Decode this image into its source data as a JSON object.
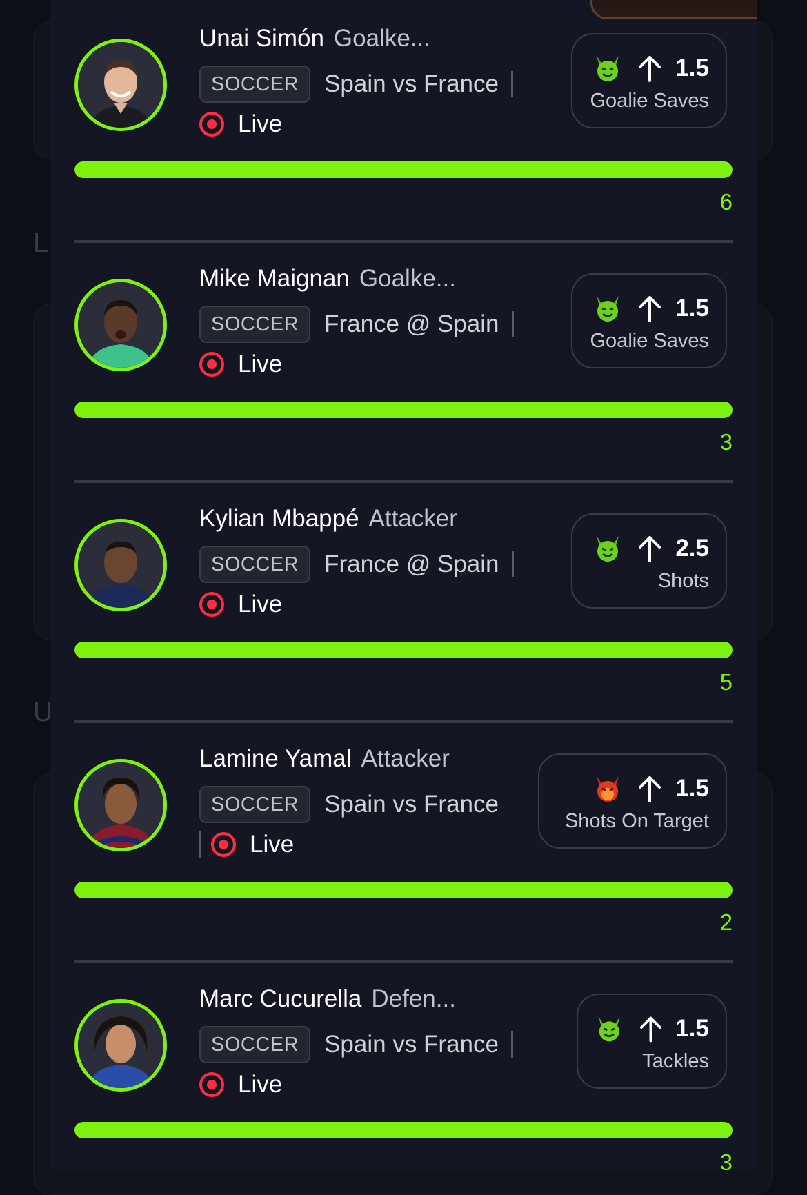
{
  "colors": {
    "accent": "#7ef20f",
    "live": "#ff2d3f",
    "panel": "#141624",
    "background": "#0d0f17"
  },
  "players": [
    {
      "name": "Unai Simón",
      "position": "Goalke...",
      "sport": "SOCCER",
      "matchup": "Spain vs France",
      "status": "Live",
      "pick_icon": "green-devil-icon",
      "direction_icon": "arrow-up-icon",
      "line": "1.5",
      "stat": "Goalie Saves",
      "progress_percent": 100,
      "current_value": "6"
    },
    {
      "name": "Mike Maignan",
      "position": "Goalke...",
      "sport": "SOCCER",
      "matchup": "France @ Spain",
      "status": "Live",
      "pick_icon": "green-devil-icon",
      "direction_icon": "arrow-up-icon",
      "line": "1.5",
      "stat": "Goalie Saves",
      "progress_percent": 100,
      "current_value": "3"
    },
    {
      "name": "Kylian Mbappé",
      "position": "Attacker",
      "sport": "SOCCER",
      "matchup": "France @ Spain",
      "status": "Live",
      "pick_icon": "green-devil-icon",
      "direction_icon": "arrow-up-icon",
      "line": "2.5",
      "stat": "Shots",
      "progress_percent": 100,
      "current_value": "5"
    },
    {
      "name": "Lamine Yamal",
      "position": "Attacker",
      "sport": "SOCCER",
      "matchup": "Spain vs France",
      "status": "Live",
      "pick_icon": "red-devil-icon",
      "direction_icon": "arrow-up-icon",
      "line": "1.5",
      "stat": "Shots On Target",
      "progress_percent": 100,
      "current_value": "2"
    },
    {
      "name": "Marc Cucurella",
      "position": "Defen...",
      "sport": "SOCCER",
      "matchup": "Spain vs France",
      "status": "Live",
      "pick_icon": "green-devil-icon",
      "direction_icon": "arrow-up-icon",
      "line": "1.5",
      "stat": "Tackles",
      "progress_percent": 100,
      "current_value": "3"
    }
  ],
  "background": {
    "letters": [
      "L",
      "U"
    ]
  }
}
